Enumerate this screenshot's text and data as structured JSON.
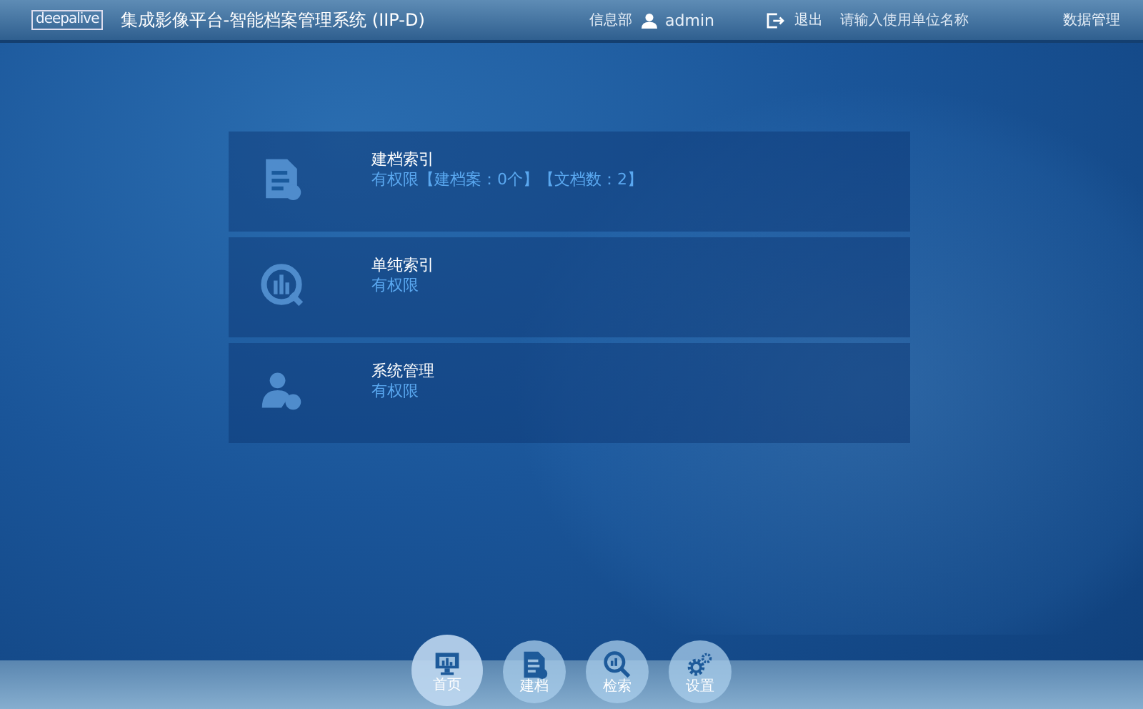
{
  "header": {
    "logo": "deepalive",
    "title": "集成影像平台-智能档案管理系统 (IIP-D)",
    "department": "信息部",
    "user": "admin",
    "logout": "退出",
    "unit_placeholder": "请输入使用单位名称",
    "data_management": "数据管理"
  },
  "modules": [
    {
      "kind": "document",
      "title": "建档索引",
      "detail": "有权限【建档案：0个】【文档数：2】"
    },
    {
      "kind": "chart-search",
      "title": "单纯索引",
      "detail": "有权限"
    },
    {
      "kind": "user-admin",
      "title": "系统管理",
      "detail": "有权限"
    }
  ],
  "dock": [
    {
      "kind": "monitor",
      "label": "首页",
      "selected": true
    },
    {
      "kind": "document",
      "label": "建档",
      "selected": false
    },
    {
      "kind": "search",
      "label": "检索",
      "selected": false
    },
    {
      "kind": "gears",
      "label": "设置",
      "selected": false
    }
  ]
}
